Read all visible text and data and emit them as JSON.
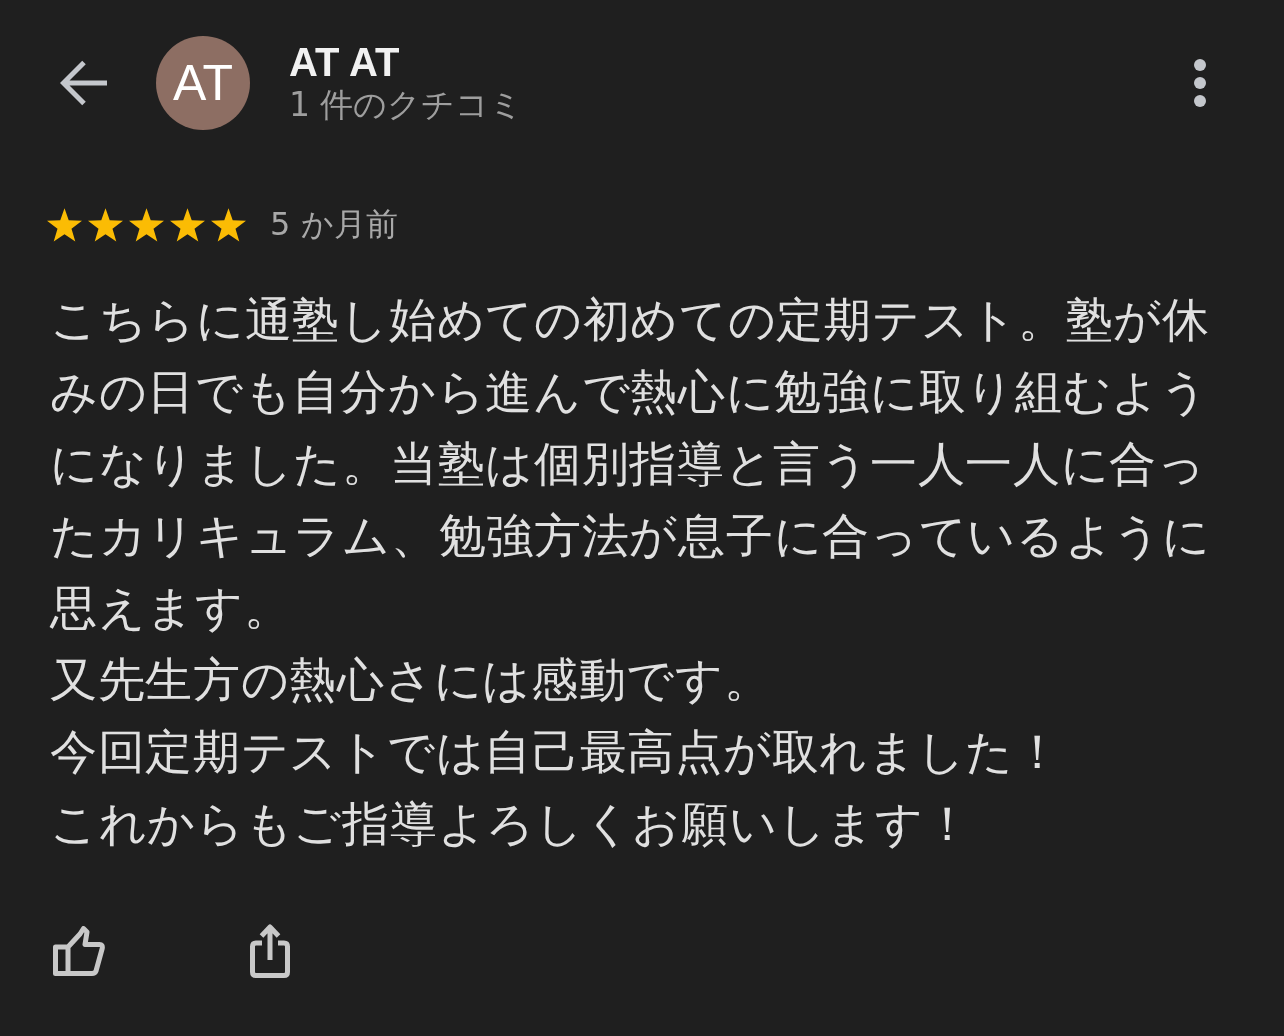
{
  "reviewer": {
    "avatar_initials": "AT",
    "name": "AT AT",
    "review_count": "1 件のクチコミ"
  },
  "review": {
    "stars": 5,
    "time": "5 か月前",
    "paragraphs": [
      "こちらに通塾し始めての初めての定期テスト。塾が休みの日でも自分から進んで熱心に勉強に取り組むようになりました。当塾は個別指導と言う一人一人に合ったカリキュラム、勉強方法が息子に合っているように思えます。",
      "又先生方の熱心さには感動です。",
      "今回定期テストでは自己最高点が取れました！",
      "これからもご指導よろしくお願いします！"
    ]
  }
}
